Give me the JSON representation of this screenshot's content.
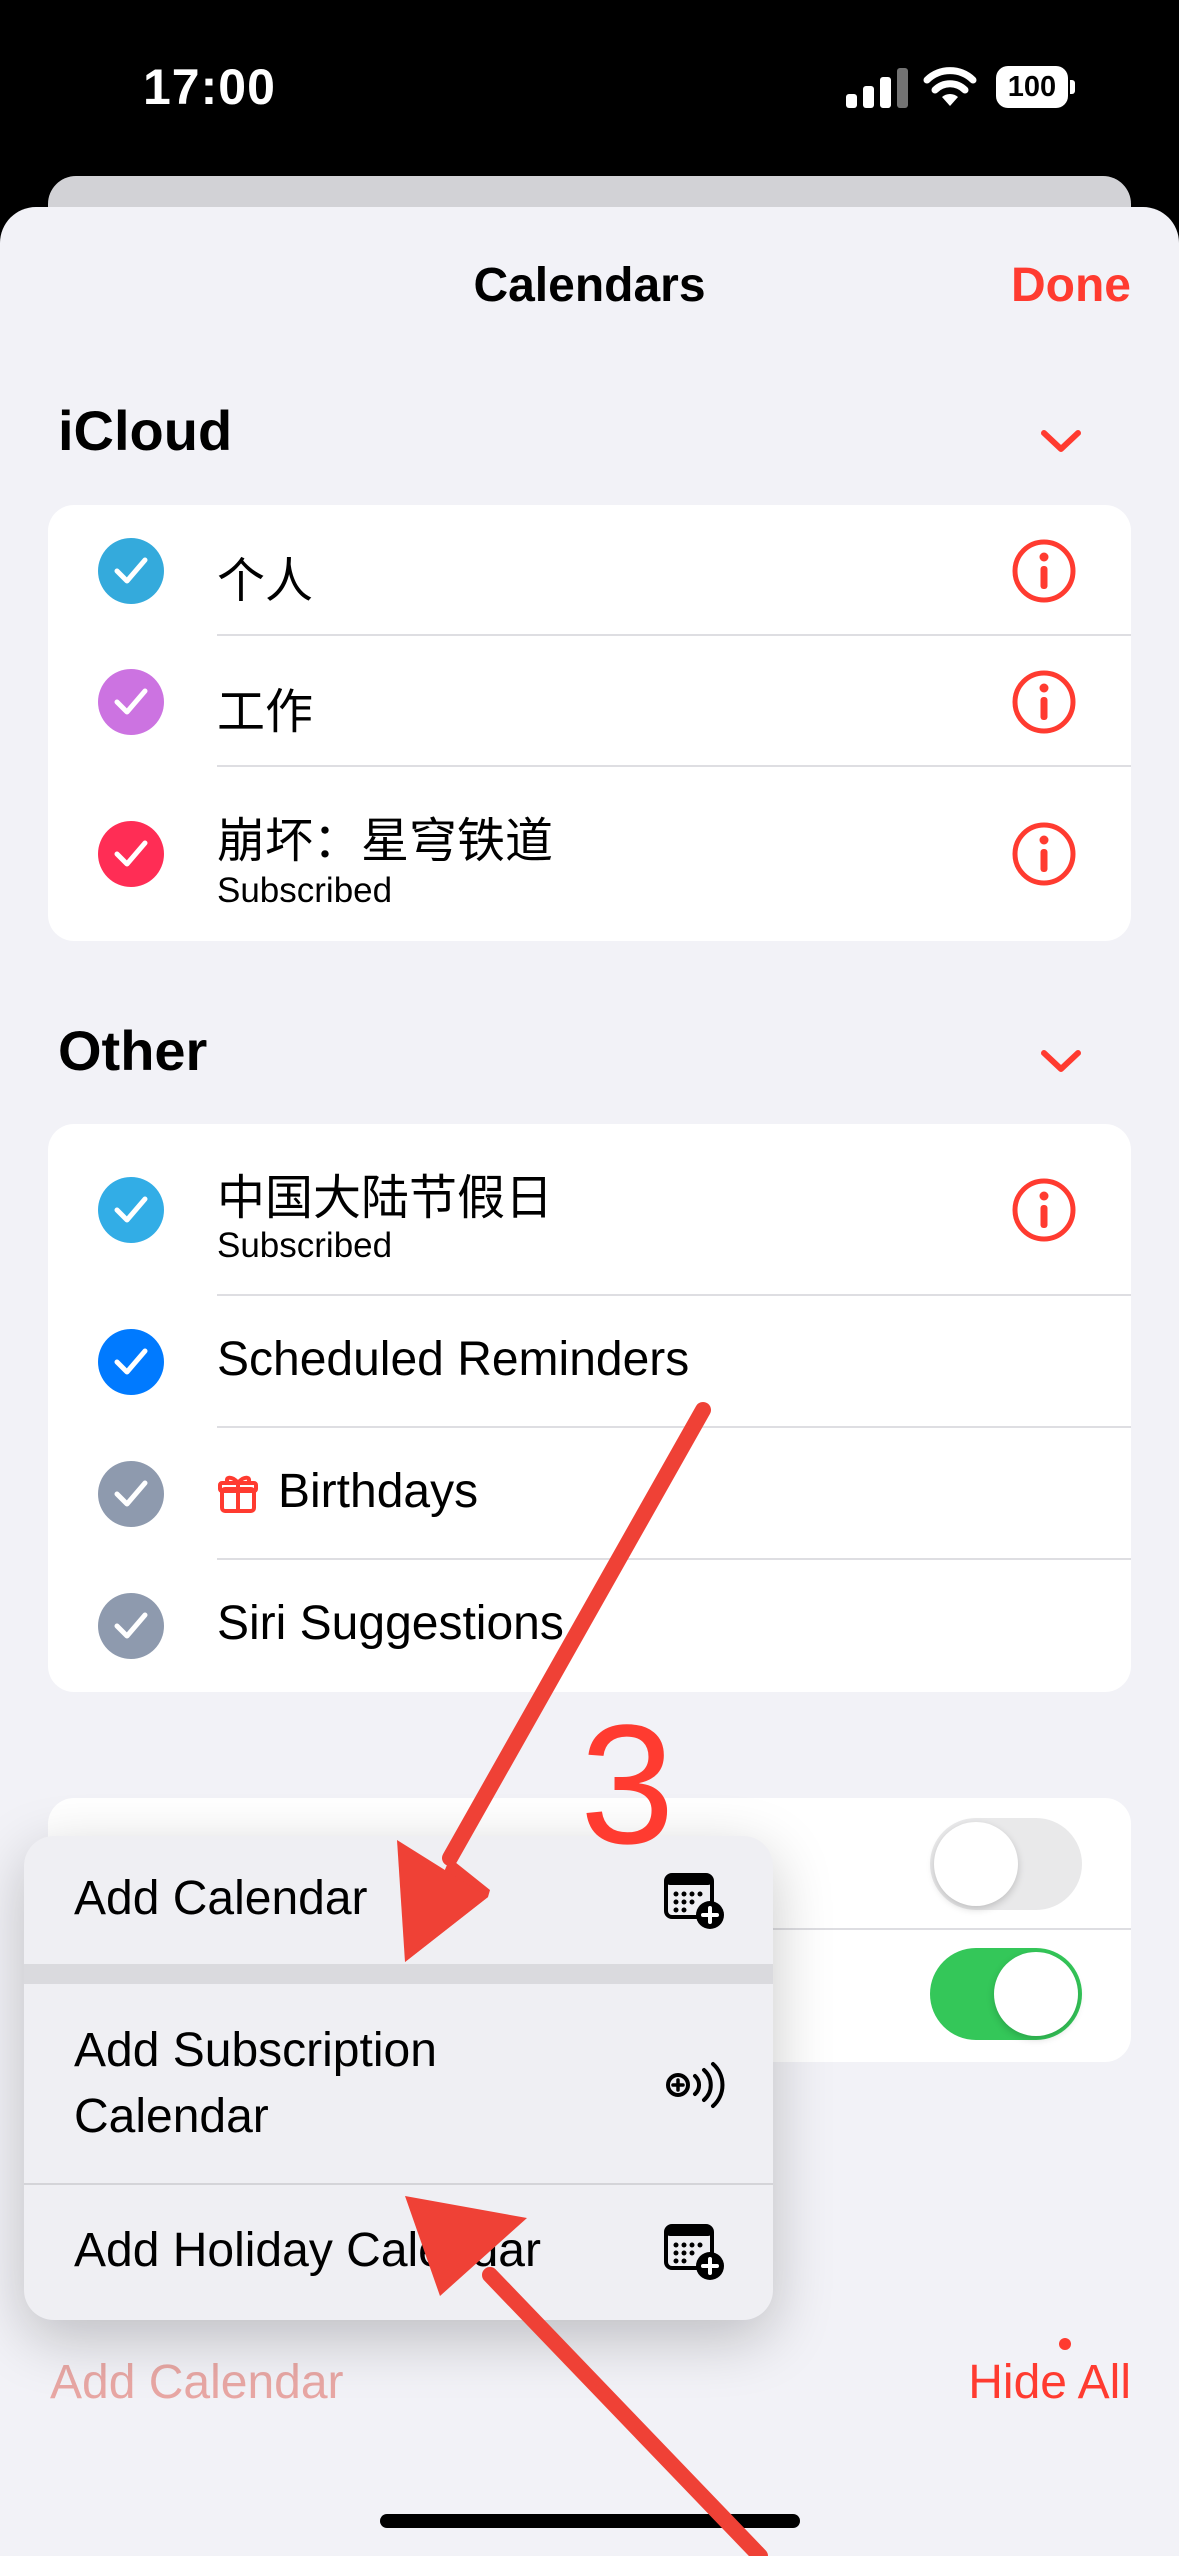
{
  "status_bar": {
    "time": "17:00",
    "battery": "100"
  },
  "header": {
    "title": "Calendars",
    "done_label": "Done"
  },
  "icloud": {
    "title": "iCloud",
    "calendars": [
      {
        "name": "个人",
        "subtitle": "",
        "color": "#34aadc"
      },
      {
        "name": "工作",
        "subtitle": "",
        "color": "#cc73e1"
      },
      {
        "name": "崩坏：星穹铁道",
        "subtitle": "Subscribed",
        "color": "#ff2d55"
      }
    ]
  },
  "other": {
    "title": "Other",
    "calendars": [
      {
        "name": "中国大陆节假日",
        "subtitle": "Subscribed",
        "color": "#32ade6"
      },
      {
        "name": "Scheduled Reminders",
        "color": "#007aff"
      },
      {
        "name": "Birthdays",
        "color": "#8e9aae",
        "icon": "gift-icon"
      },
      {
        "name": "Siri Suggestions",
        "color": "#8e9aae"
      }
    ]
  },
  "toggles": [
    {
      "on": false
    },
    {
      "on": true
    }
  ],
  "menu": {
    "items": [
      {
        "label": "Add Calendar",
        "icon": "calendar-add-icon"
      },
      {
        "label_line1": "Add Subscription",
        "label_line2": "Calendar",
        "icon": "subscription-add-icon"
      },
      {
        "label": "Add Holiday Calendar",
        "icon": "calendar-add-icon"
      }
    ]
  },
  "bottom_bar": {
    "add_calendar": "Add Calendar",
    "hide_all": "Hide All"
  },
  "annotation": {
    "step_number": "3",
    "color": "#ef4136"
  },
  "colors": {
    "accent": "#ff3b30",
    "toggle_on": "#34c759",
    "toggle_off": "#e9e9ea"
  }
}
